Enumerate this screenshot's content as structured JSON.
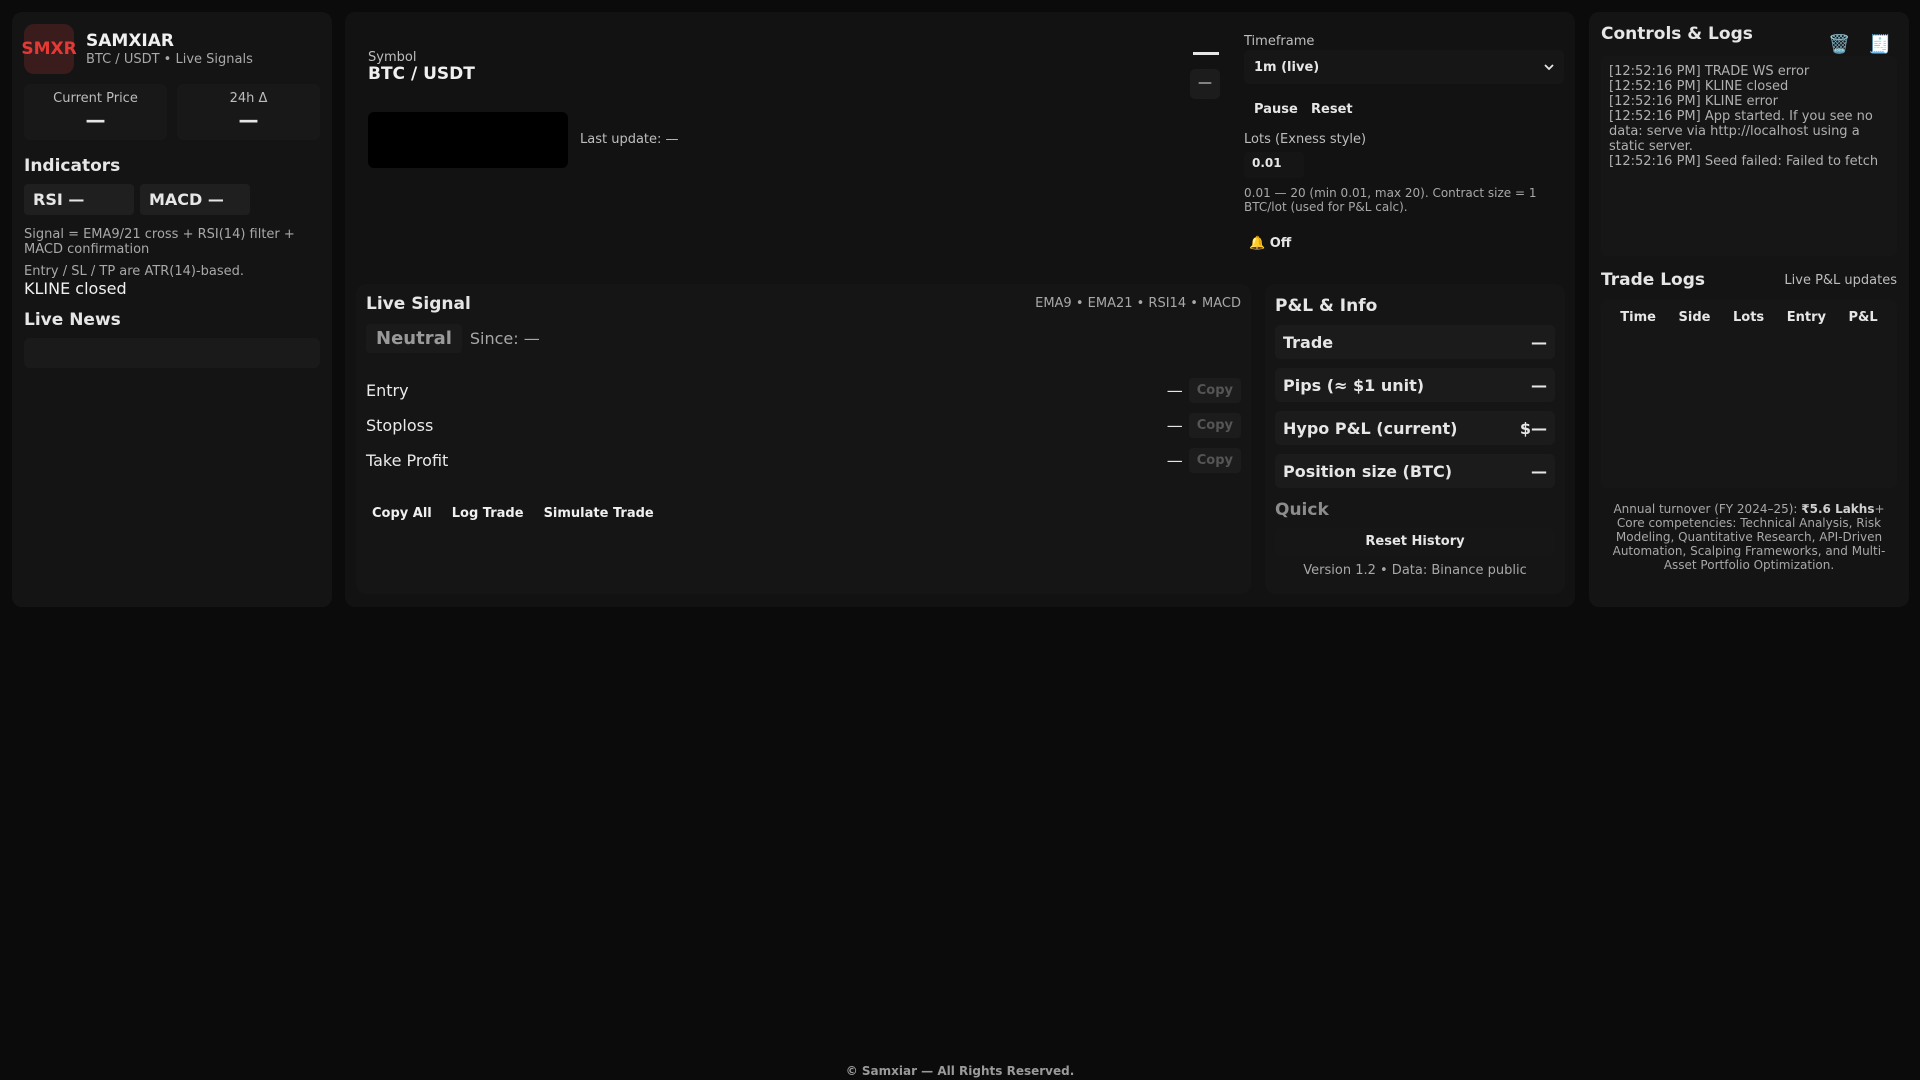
{
  "brand": {
    "logo": "SMXR",
    "name": "SAMXIAR",
    "subtitle": "BTC / USDT • Live Signals"
  },
  "stats": [
    {
      "label": "Current Price",
      "value": "—"
    },
    {
      "label": "24h Δ",
      "value": "—"
    }
  ],
  "indicators": {
    "title": "Indicators",
    "rsi": "RSI —",
    "macd": "MACD —",
    "desc1": "Signal = EMA9/21 cross + RSI(14) filter + MACD confirmation",
    "desc2": "Entry / SL / TP are ATR(14)-based.",
    "status": "KLINE closed"
  },
  "news": {
    "title": "Live News"
  },
  "symbol": {
    "label": "Symbol",
    "value": "BTC / USDT",
    "last_update": "Last update: —",
    "dash_button": "—"
  },
  "controls": {
    "timeframe_label": "Timeframe",
    "timeframe_value": "1m (live)",
    "pause": "Pause",
    "reset": "Reset",
    "lots_label": "Lots (Exness style)",
    "lots_value": "0.01",
    "lots_note": "0.01 — 20 (min 0.01, max 20). Contract size = 1 BTC/lot (used for P&L calc).",
    "alert": "🔔 Off"
  },
  "signal": {
    "title": "Live Signal",
    "tags": "EMA9 • EMA21 • RSI14 • MACD",
    "state": "Neutral",
    "since": "Since: —",
    "levels": [
      {
        "label": "Entry",
        "value": "—",
        "copy": "Copy"
      },
      {
        "label": "Stoploss",
        "value": "—",
        "copy": "Copy"
      },
      {
        "label": "Take Profit",
        "value": "—",
        "copy": "Copy"
      }
    ],
    "actions": {
      "copy_all": "Copy All",
      "log_trade": "Log Trade",
      "simulate": "Simulate Trade"
    }
  },
  "pnl": {
    "title": "P&L & Info",
    "rows": [
      {
        "label": "Trade",
        "value": "—"
      },
      {
        "label": "Pips (≈ $1 unit)",
        "value": "—"
      },
      {
        "label": "Hypo P&L (current)",
        "value": "$—"
      },
      {
        "label": "Position size (BTC)",
        "value": "—"
      }
    ],
    "quick": "Quick",
    "reset_history": "Reset History",
    "version": "Version 1.2 • Data: Binance public"
  },
  "logs": {
    "title": "Controls & Logs",
    "icons": [
      "trash-icon",
      "receipt-icon"
    ],
    "lines": [
      "[12:52:16 PM] TRADE WS error",
      "[12:52:16 PM] KLINE closed",
      "[12:52:16 PM] KLINE error",
      "[12:52:16 PM] App started. If you see no data: serve via http://localhost using a static server.",
      "[12:52:16 PM] Seed failed: Failed to fetch"
    ]
  },
  "trade_logs": {
    "title": "Trade Logs",
    "subtitle": "Live P&L updates",
    "columns": [
      "Time",
      "Side",
      "Lots",
      "Entry",
      "P&L"
    ]
  },
  "about": {
    "line_prefix": "Annual turnover (FY 2024–25): ",
    "turnover": "₹5.6 Lakhs",
    "line_suffix": "+ Core competencies: Technical Analysis, Risk Modeling, Quantitative Research, API-Driven Automation, Scalping Frameworks, and Multi-Asset Portfolio Optimization."
  },
  "copyright": "© Samxiar — All Rights Reserved."
}
